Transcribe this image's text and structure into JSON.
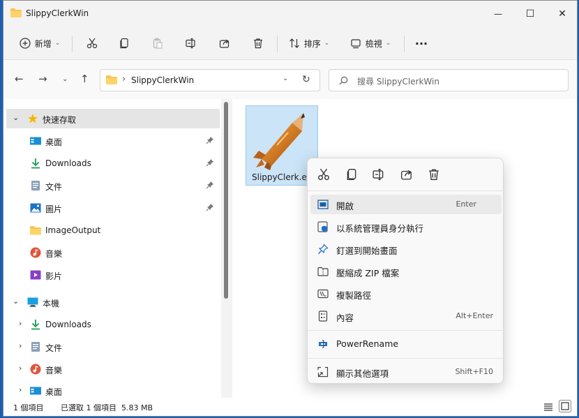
{
  "window": {
    "title": "SlippyClerkWin",
    "minimize": "—",
    "maximize": "☐",
    "close": "✕"
  },
  "toolbar": {
    "new_label": "新增",
    "sort_label": "排序",
    "view_label": "檢視",
    "more": "···"
  },
  "address": {
    "separator": "›",
    "folder": "SlippyClerkWin",
    "search_placeholder": "搜尋 SlippyClerkWin"
  },
  "sidebar": {
    "quick_access": {
      "label": "快速存取"
    },
    "quick_items": [
      {
        "label": "桌面",
        "icon": "desktop-icon",
        "pinned": true
      },
      {
        "label": "Downloads",
        "icon": "download-icon",
        "pinned": true
      },
      {
        "label": "文件",
        "icon": "documents-icon",
        "pinned": true
      },
      {
        "label": "圖片",
        "icon": "pictures-icon",
        "pinned": true
      },
      {
        "label": "ImageOutput",
        "icon": "folder-icon",
        "pinned": false
      },
      {
        "label": "音樂",
        "icon": "music-icon",
        "pinned": false
      },
      {
        "label": "影片",
        "icon": "videos-icon",
        "pinned": false
      }
    ],
    "this_pc": {
      "label": "本機"
    },
    "pc_items": [
      {
        "label": "Downloads",
        "icon": "download-icon"
      },
      {
        "label": "文件",
        "icon": "documents-icon"
      },
      {
        "label": "音樂",
        "icon": "music-icon"
      },
      {
        "label": "桌面",
        "icon": "desktop-icon"
      }
    ]
  },
  "content": {
    "file": {
      "name": "SlippyClerk.exe",
      "name_visible": "SlippyClerk.ex",
      "icon": "rocket-pencil-icon"
    }
  },
  "context_menu": {
    "quick_actions": [
      "cut-icon",
      "copy-icon",
      "rename-icon",
      "share-icon",
      "delete-icon"
    ],
    "items": [
      {
        "label": "開啟",
        "shortcut": "Enter",
        "icon": "open-icon",
        "highlighted": true
      },
      {
        "label": "以系統管理員身分執行",
        "shortcut": "",
        "icon": "shield-icon"
      },
      {
        "label": "釘選到開始畫面",
        "shortcut": "",
        "icon": "pin-icon"
      },
      {
        "label": "壓縮成 ZIP 檔案",
        "shortcut": "",
        "icon": "zip-icon"
      },
      {
        "label": "複製路徑",
        "shortcut": "",
        "icon": "copy-path-icon"
      },
      {
        "label": "內容",
        "shortcut": "Alt+Enter",
        "icon": "properties-icon"
      },
      {
        "label": "PowerRename",
        "shortcut": "",
        "icon": "powerrename-icon"
      },
      {
        "label": "顯示其他選項",
        "shortcut": "Shift+F10",
        "icon": "more-options-icon"
      }
    ]
  },
  "status": {
    "item_count": "1 個項目",
    "selected": "已選取 1 個項目  5.83 MB"
  },
  "colors": {
    "accent": "#0067c0",
    "selection": "#cce4f7",
    "folder": "#f8c44f"
  }
}
